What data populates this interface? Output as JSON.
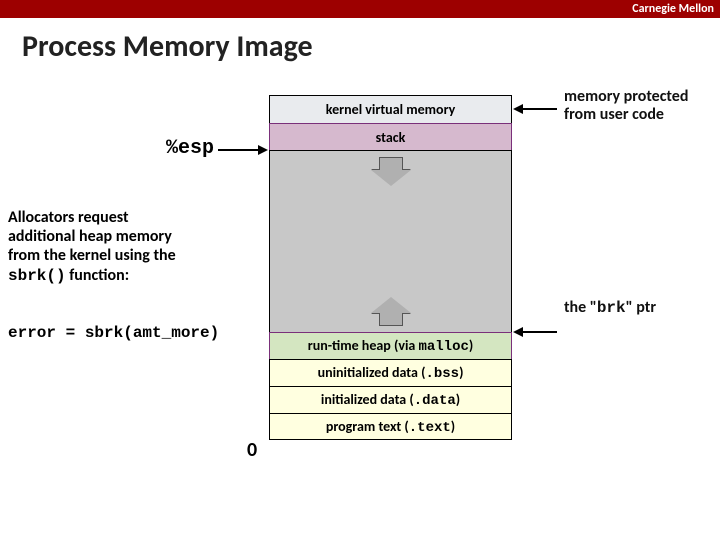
{
  "header": {
    "org": "Carnegie Mellon",
    "title": "Process Memory Image"
  },
  "segments": {
    "kvm": "kernel virtual memory",
    "stack": "stack",
    "heap_pre": "run-time heap (via ",
    "heap_code": "malloc",
    "heap_post": ")",
    "bss_pre": "uninitialized data (",
    "bss_code": ".bss",
    "bss_post": ")",
    "data_pre": "initialized data (",
    "data_code": ".data",
    "data_post": ")",
    "text_pre": "program text (",
    "text_code": ".text",
    "text_post": ")"
  },
  "labels": {
    "esp": "%esp",
    "zero": "0",
    "kv_note": "memory protected from user code",
    "brk_pre": "the \"",
    "brk_code": "brk",
    "brk_post": "\" ptr"
  },
  "allocator_note": {
    "l1": "Allocators request",
    "l2": "additional heap memory",
    "l3": "from the kernel using the",
    "l4a": "sbrk()",
    "l4b": " function:"
  },
  "error_line": "error = sbrk(amt_more)"
}
